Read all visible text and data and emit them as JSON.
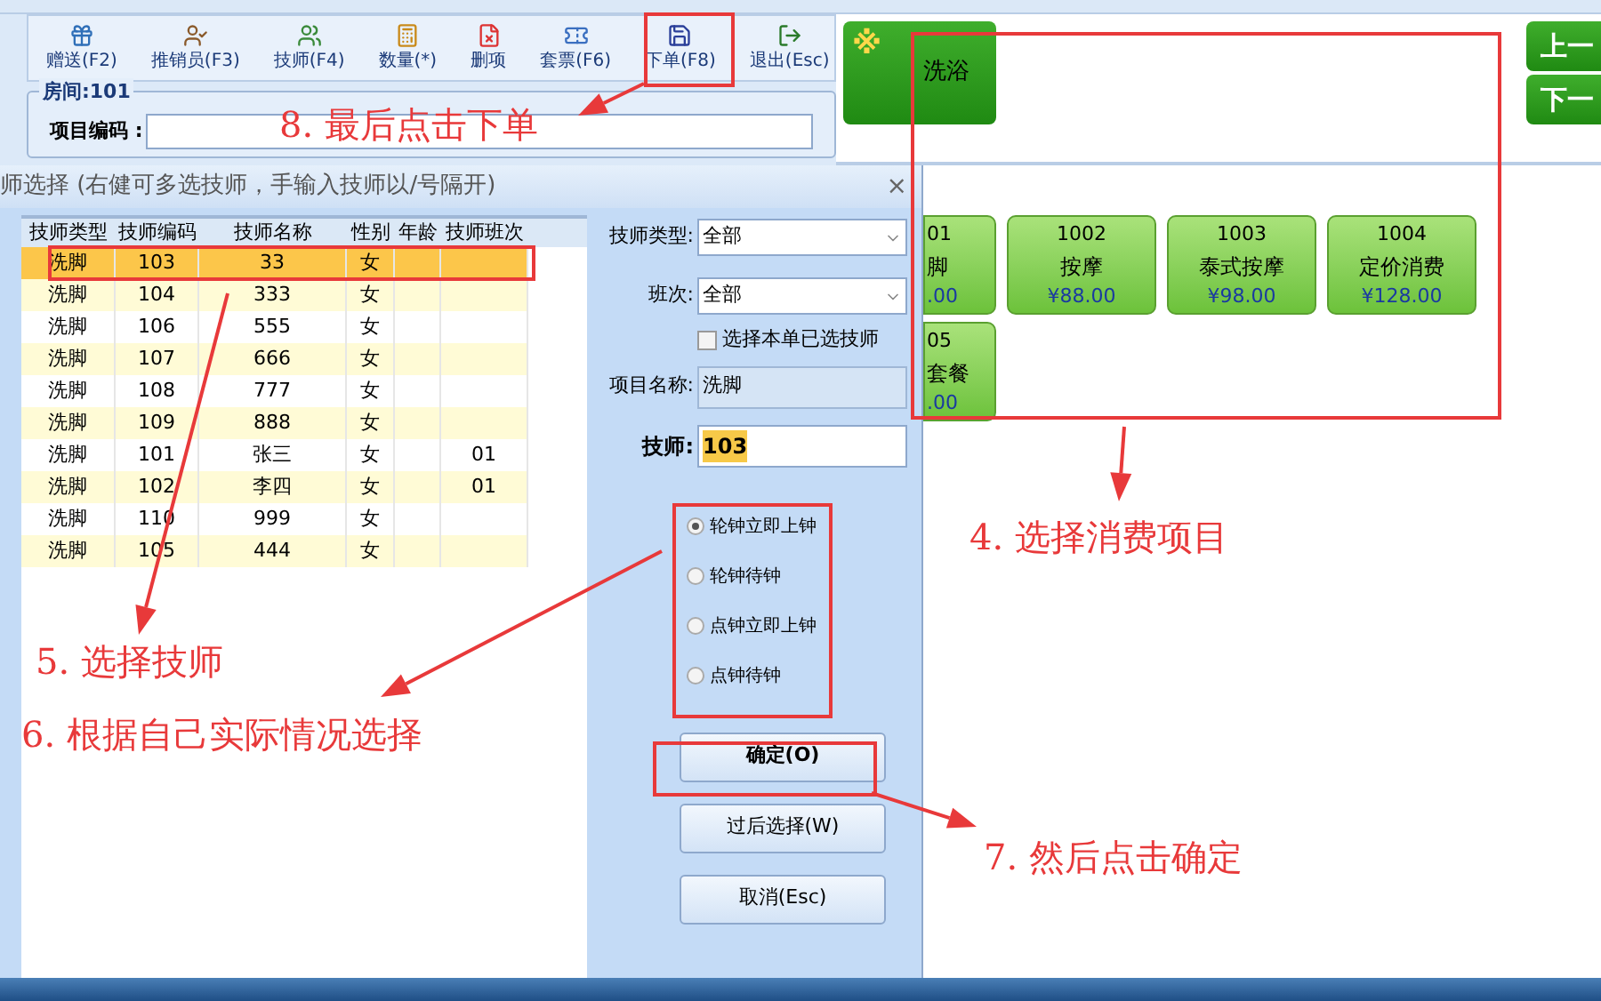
{
  "toolbar": [
    {
      "label": "赠送(F2)"
    },
    {
      "label": "推销员(F3)"
    },
    {
      "label": "技师(F4)"
    },
    {
      "label": "数量(*)"
    },
    {
      "label": "删项"
    },
    {
      "label": "套票(F6)"
    },
    {
      "label": "下单(F8)"
    },
    {
      "label": "退出(Esc)"
    }
  ],
  "room": {
    "title": "房间:101",
    "code_label": "项目编码 :"
  },
  "category": {
    "mark": "※",
    "label": "洗浴"
  },
  "paging": [
    "上一",
    "下一"
  ],
  "items": [
    {
      "kind": "cut",
      "code": "01",
      "name": "脚",
      "price": ".00"
    },
    {
      "kind": "full",
      "code": "1002",
      "name": "按摩",
      "price": "¥88.00"
    },
    {
      "kind": "full",
      "code": "1003",
      "name": "泰式按摩",
      "price": "¥98.00"
    },
    {
      "kind": "full",
      "code": "1004",
      "name": "定价消费",
      "price": "¥128.00"
    },
    {
      "kind": "cut",
      "code": "05",
      "name": "套餐",
      "price": ".00"
    }
  ],
  "dialog": {
    "title": "师选择 (右健可多选技师，手输入技师以/号隔开)",
    "close": "×",
    "columns": [
      "技师类型",
      "技师编码",
      "技师名称",
      "性别",
      "年龄",
      "技师班次"
    ],
    "rows": [
      {
        "cells": [
          "洗脚",
          "103",
          "33",
          "女",
          "",
          ""
        ],
        "selected": true
      },
      {
        "cells": [
          "洗脚",
          "104",
          "333",
          "女",
          "",
          ""
        ],
        "selected": false
      },
      {
        "cells": [
          "洗脚",
          "106",
          "555",
          "女",
          "",
          ""
        ],
        "selected": false
      },
      {
        "cells": [
          "洗脚",
          "107",
          "666",
          "女",
          "",
          ""
        ],
        "selected": false
      },
      {
        "cells": [
          "洗脚",
          "108",
          "777",
          "女",
          "",
          ""
        ],
        "selected": false
      },
      {
        "cells": [
          "洗脚",
          "109",
          "888",
          "女",
          "",
          ""
        ],
        "selected": false
      },
      {
        "cells": [
          "洗脚",
          "101",
          "张三",
          "女",
          "",
          "01"
        ],
        "selected": false
      },
      {
        "cells": [
          "洗脚",
          "102",
          "李四",
          "女",
          "",
          "01"
        ],
        "selected": false
      },
      {
        "cells": [
          "洗脚",
          "110",
          "999",
          "女",
          "",
          ""
        ],
        "selected": false
      },
      {
        "cells": [
          "洗脚",
          "105",
          "444",
          "女",
          "",
          ""
        ],
        "selected": false
      }
    ],
    "type_label": "技师类型:",
    "type_value": "全部",
    "shift_label": "班次:",
    "shift_value": "全部",
    "checkbox": {
      "label": "选择本单已选技师",
      "checked": false
    },
    "item_label": "项目名称:",
    "item_value": "洗脚",
    "tech_label": "技师:",
    "tech_value": "103",
    "options": [
      {
        "label": "轮钟立即上钟",
        "selected": true
      },
      {
        "label": "轮钟待钟",
        "selected": false
      },
      {
        "label": "点钟立即上钟",
        "selected": false
      },
      {
        "label": "点钟待钟",
        "selected": false
      }
    ],
    "buttons": [
      "确定(O)",
      "过后选择(W)",
      "取消(Esc)"
    ]
  },
  "annotations": [
    "8. 最后点击下单",
    "4. 选择消费项目",
    "5. 选择技师",
    "6. 根据自己实际情况选择",
    "7. 然后点击确定"
  ]
}
